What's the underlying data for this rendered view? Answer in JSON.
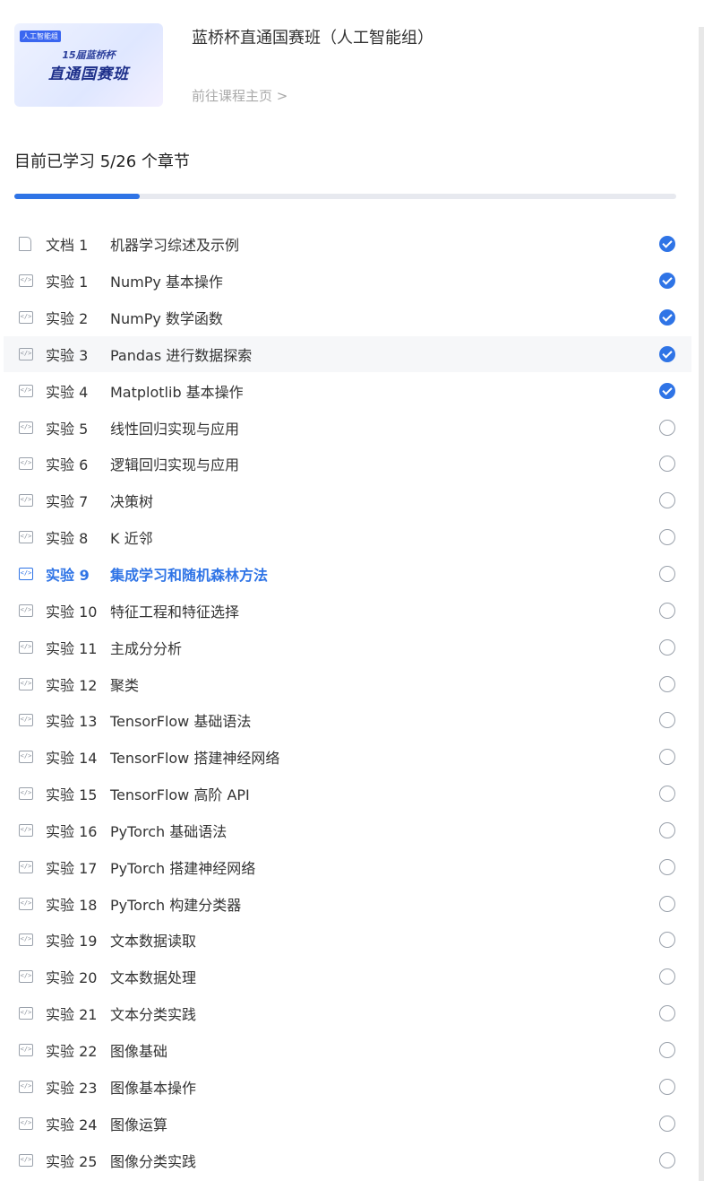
{
  "course": {
    "thumbnail": {
      "tag": "人工智能组",
      "subtitle": "15届蓝桥杯",
      "title": "直通国赛班"
    },
    "title": "蓝桥杯直通国赛班（人工智能组）",
    "link_label": "前往课程主页 >"
  },
  "progress": {
    "text": "目前已学习 5/26 个章节",
    "completed": 5,
    "total": 26,
    "fraction": 0.19,
    "accent_color": "#2f74e6"
  },
  "chapters": [
    {
      "kind": "文档 1",
      "name": "机器学习综述及示例",
      "icon": "document-icon",
      "done": true
    },
    {
      "kind": "实验 1",
      "name": "NumPy 基本操作",
      "icon": "code-icon",
      "done": true
    },
    {
      "kind": "实验 2",
      "name": "NumPy 数学函数",
      "icon": "code-icon",
      "done": true
    },
    {
      "kind": "实验 3",
      "name": "Pandas 进行数据探索",
      "icon": "code-icon",
      "done": true,
      "hovered": true
    },
    {
      "kind": "实验 4",
      "name": "Matplotlib 基本操作",
      "icon": "code-icon",
      "done": true
    },
    {
      "kind": "实验 5",
      "name": "线性回归实现与应用",
      "icon": "code-icon",
      "done": false
    },
    {
      "kind": "实验 6",
      "name": "逻辑回归实现与应用",
      "icon": "code-icon",
      "done": false
    },
    {
      "kind": "实验 7",
      "name": "决策树",
      "icon": "code-icon",
      "done": false
    },
    {
      "kind": "实验 8",
      "name": "K 近邻",
      "icon": "code-icon",
      "done": false
    },
    {
      "kind": "实验 9",
      "name": "集成学习和随机森林方法",
      "icon": "code-icon",
      "done": false,
      "active": true
    },
    {
      "kind": "实验 10",
      "name": "特征工程和特征选择",
      "icon": "code-icon",
      "done": false
    },
    {
      "kind": "实验 11",
      "name": "主成分分析",
      "icon": "code-icon",
      "done": false
    },
    {
      "kind": "实验 12",
      "name": "聚类",
      "icon": "code-icon",
      "done": false
    },
    {
      "kind": "实验 13",
      "name": "TensorFlow 基础语法",
      "icon": "code-icon",
      "done": false
    },
    {
      "kind": "实验 14",
      "name": "TensorFlow 搭建神经网络",
      "icon": "code-icon",
      "done": false
    },
    {
      "kind": "实验 15",
      "name": "TensorFlow 高阶 API",
      "icon": "code-icon",
      "done": false
    },
    {
      "kind": "实验 16",
      "name": "PyTorch 基础语法",
      "icon": "code-icon",
      "done": false
    },
    {
      "kind": "实验 17",
      "name": "PyTorch 搭建神经网络",
      "icon": "code-icon",
      "done": false
    },
    {
      "kind": "实验 18",
      "name": "PyTorch 构建分类器",
      "icon": "code-icon",
      "done": false
    },
    {
      "kind": "实验 19",
      "name": "文本数据读取",
      "icon": "code-icon",
      "done": false
    },
    {
      "kind": "实验 20",
      "name": "文本数据处理",
      "icon": "code-icon",
      "done": false
    },
    {
      "kind": "实验 21",
      "name": "文本分类实践",
      "icon": "code-icon",
      "done": false
    },
    {
      "kind": "实验 22",
      "name": "图像基础",
      "icon": "code-icon",
      "done": false
    },
    {
      "kind": "实验 23",
      "name": "图像基本操作",
      "icon": "code-icon",
      "done": false
    },
    {
      "kind": "实验 24",
      "name": "图像运算",
      "icon": "code-icon",
      "done": false
    },
    {
      "kind": "实验 25",
      "name": "图像分类实践",
      "icon": "code-icon",
      "done": false
    }
  ]
}
